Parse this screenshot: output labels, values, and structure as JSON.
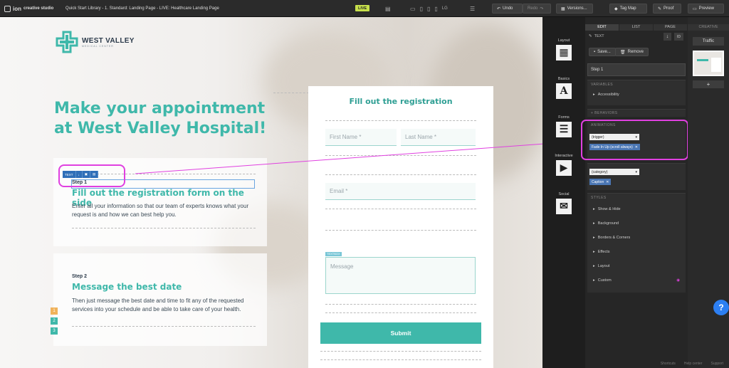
{
  "topbar": {
    "app_name": "creative studio",
    "logo": "ion",
    "breadcrumb": "Quick Start Library - 1. Standard: Landing Page - LIVE: Healthcare Landing Page",
    "live_badge": "LIVE",
    "device_label": "LG",
    "undo": "Undo",
    "redo": "Redo",
    "versions": "Versions...",
    "tag_map": "Tag Map",
    "proof": "Proof",
    "preview": "Preview"
  },
  "page": {
    "logo_text": "WEST VALLEY",
    "logo_sub": "MEDICAL CENTER",
    "hero_title": "Make your appointment at West Valley Hospital!",
    "steps": [
      {
        "label": "Step 1",
        "title": "Fill out the registration form on the side",
        "desc": "Enter all your information so that our team of experts knows what your request is and how we can best help you."
      },
      {
        "label": "Step 2",
        "title": "Message the best date",
        "desc": "Then just message the best date and time to fit any of the requested services into your schedule and be able to take care of your health."
      }
    ],
    "step_numbers": [
      "1",
      "2",
      "3"
    ],
    "step_colors": [
      "#f0b25a",
      "#3fb8aa",
      "#3fb8aa"
    ],
    "text_toolbar": "TEXT",
    "form": {
      "title": "Fill out the registration",
      "first_name": "First Name *",
      "last_name": "Last Name *",
      "email": "Email *",
      "message_tag": "TEXTBOX",
      "message": "Message",
      "submit": "Submit"
    }
  },
  "editor_sidebar": [
    {
      "label": "Layout",
      "icon": "layout-icon"
    },
    {
      "label": "Basics",
      "icon": "text-icon"
    },
    {
      "label": "Forms",
      "icon": "forms-icon"
    },
    {
      "label": "Interactive",
      "icon": "play-icon"
    },
    {
      "label": "Social",
      "icon": "chat-icon"
    }
  ],
  "edit_panel": {
    "tabs": [
      "EDIT",
      "LIST",
      "PAGE"
    ],
    "element_type": "TEXT",
    "save": "Save...",
    "remove": "Remove",
    "element_name": "Step 1",
    "variables_head": "VARIABLES",
    "accessibility": "Accessibility",
    "behaviors_head": "+ BEHAVIORS",
    "animations_head": "ANIMATIONS",
    "trigger_select": "(trigger)",
    "animation_chip": "Fade In Up (scroll always)",
    "category_select": "(category)",
    "caption_chip": "Caption",
    "styles_head": "STYLES",
    "styles": [
      "Show & Hide",
      "Background",
      "Borders & Corners",
      "Effects",
      "Layout",
      "Custom"
    ]
  },
  "creative_panel": {
    "head": "CREATIVE",
    "traffic": "Traffic",
    "add": "+"
  },
  "status_bar": [
    "Shortcuts",
    "Help center",
    "Support"
  ],
  "colors": {
    "accent": "#3fb8aa",
    "highlight": "#e040e0",
    "chip": "#4b77b5"
  }
}
